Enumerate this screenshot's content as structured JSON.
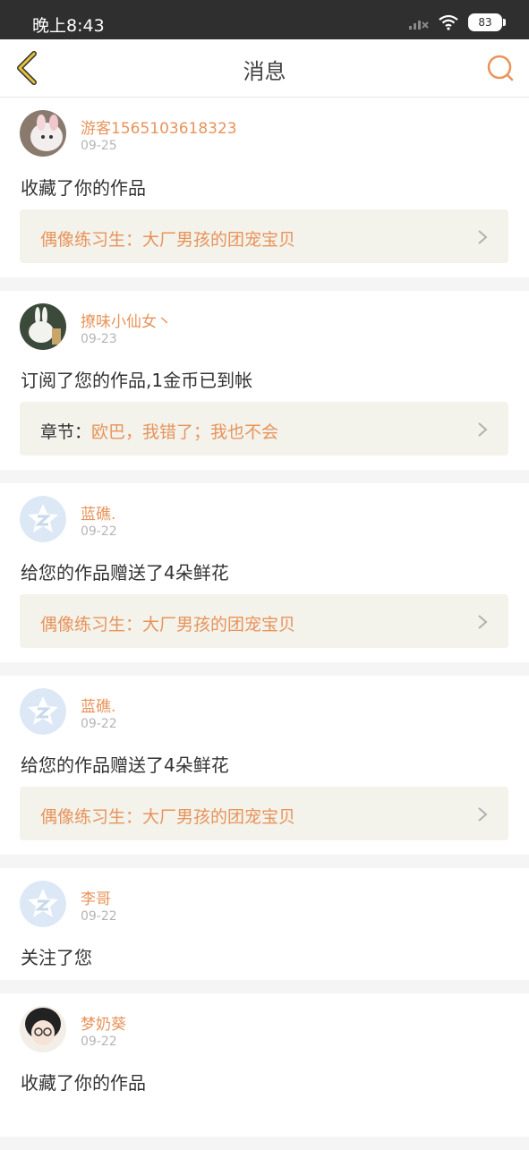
{
  "status_bar": {
    "time": "晚上8:43",
    "battery": "83"
  },
  "header": {
    "title": "消息"
  },
  "messages": [
    {
      "user": "游客1565103618323",
      "date": "09-25",
      "action": "收藏了你的作品",
      "work_prefix": "",
      "work_title": "偶像练习生：大厂男孩的团宠宝贝"
    },
    {
      "user": "撩味小仙女丶",
      "date": "09-23",
      "action": "订阅了您的作品,1金币已到帐",
      "work_prefix": "章节：",
      "work_title": "欧巴，我错了；我也不会"
    },
    {
      "user": "蓝礁.",
      "date": "09-22",
      "action": "给您的作品赠送了4朵鲜花",
      "work_prefix": "",
      "work_title": "偶像练习生：大厂男孩的团宠宝贝"
    },
    {
      "user": "蓝礁.",
      "date": "09-22",
      "action": "给您的作品赠送了4朵鲜花",
      "work_prefix": "",
      "work_title": "偶像练习生：大厂男孩的团宠宝贝"
    },
    {
      "user": "李哥",
      "date": "09-22",
      "action": "关注了您"
    },
    {
      "user": "梦奶葵",
      "date": "09-22",
      "action": "收藏了你的作品"
    }
  ],
  "colors": {
    "accent": "#e8935a",
    "back_icon": "#e8c23a",
    "card_bg": "#f3f3ec"
  }
}
